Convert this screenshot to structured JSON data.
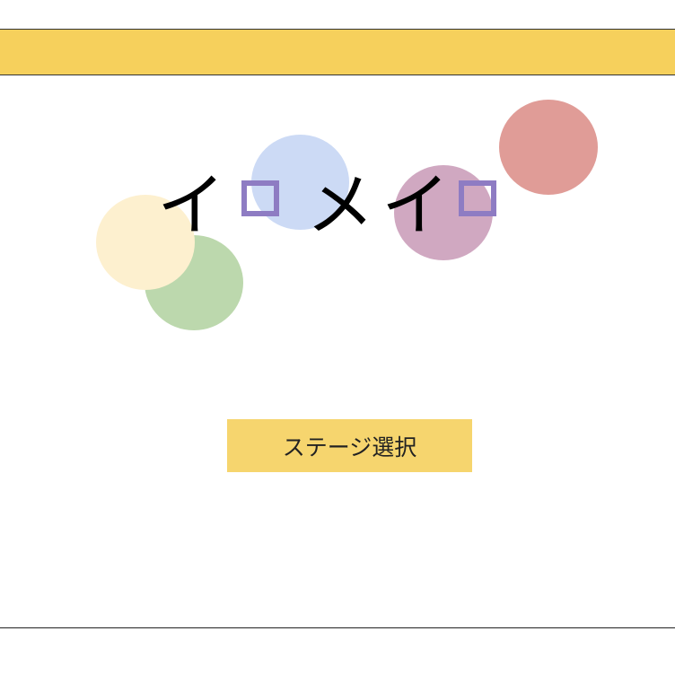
{
  "title": {
    "chars": [
      "イ",
      "ロ",
      "メ",
      "イ",
      "ロ"
    ]
  },
  "menu": {
    "stage_select_label": "ステージ選択"
  },
  "colors": {
    "header_bar": "#f6d05c",
    "button": "#f6d56e",
    "box_glyph": "#8e7cc3",
    "circle_green": "#bcd8ad",
    "circle_cream": "#fdf0cf",
    "circle_blue": "#ccdaf5",
    "circle_purple": "#d0a8c1",
    "circle_red": "#e09c97"
  }
}
